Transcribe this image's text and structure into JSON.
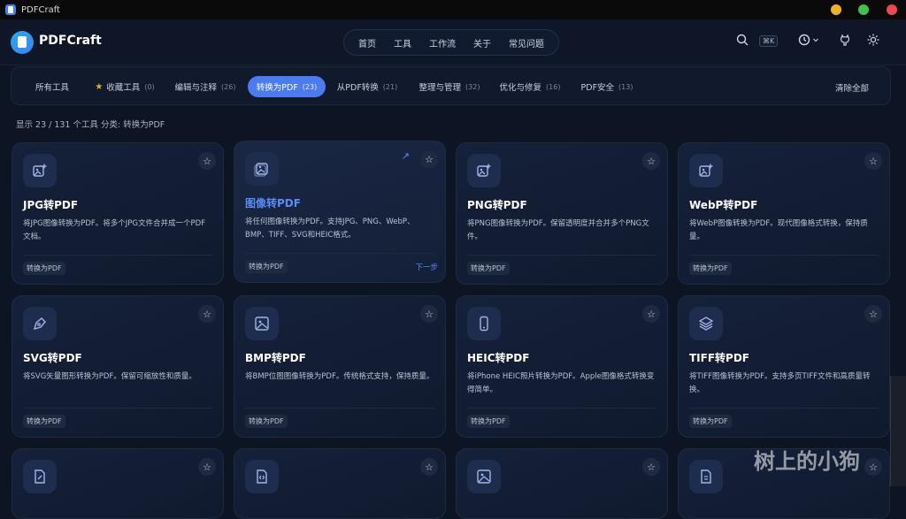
{
  "window": {
    "title": "PDFCraft"
  },
  "colors": {
    "accent": "#4c7bf0",
    "star": "#f5a524",
    "mac_yellow": "#f5b125",
    "mac_green": "#3ec04a",
    "mac_red": "#f04848"
  },
  "header": {
    "brand": "PDFCraft",
    "nav": [
      "首页",
      "工具",
      "工作流",
      "关于",
      "常见问题"
    ],
    "shortcut": "⌘K"
  },
  "filters": {
    "items": [
      {
        "label": "所有工具",
        "count": ""
      },
      {
        "label": "收藏工具",
        "count": "(0)"
      },
      {
        "label": "编辑与注释",
        "count": "(26)"
      },
      {
        "label": "转换为PDF",
        "count": "(23)"
      },
      {
        "label": "从PDF转换",
        "count": "(21)"
      },
      {
        "label": "整理与管理",
        "count": "(32)"
      },
      {
        "label": "优化与修复",
        "count": "(16)"
      },
      {
        "label": "PDF安全",
        "count": "(13)"
      }
    ],
    "clear": "清除全部"
  },
  "status": "显示 23 / 131 个工具 分类: 转换为PDF",
  "cards": [
    {
      "title": "JPG转PDF",
      "desc": "将JPG图像转换为PDF。将多个JPG文件合并成一个PDF文档。",
      "tag": "转换为PDF",
      "icon": "image-plus-icon"
    },
    {
      "title": "图像转PDF",
      "desc": "将任何图像转换为PDF。支持JPG、PNG、WebP、BMP、TIFF、SVG和HEIC格式。",
      "tag": "转换为PDF",
      "next": "下一步",
      "icon": "images-icon"
    },
    {
      "title": "PNG转PDF",
      "desc": "将PNG图像转换为PDF。保留透明度并合并多个PNG文件。",
      "tag": "转换为PDF",
      "icon": "image-plus-icon"
    },
    {
      "title": "WebP转PDF",
      "desc": "将WebP图像转换为PDF。现代图像格式转换，保持质量。",
      "tag": "转换为PDF",
      "icon": "image-plus-icon"
    },
    {
      "title": "SVG转PDF",
      "desc": "将SVG矢量图形转换为PDF。保留可缩放性和质量。",
      "tag": "转换为PDF",
      "icon": "pen-tool-icon"
    },
    {
      "title": "BMP转PDF",
      "desc": "将BMP位图图像转换为PDF。传统格式支持，保持质量。",
      "tag": "转换为PDF",
      "icon": "image-icon"
    },
    {
      "title": "HEIC转PDF",
      "desc": "将iPhone HEIC照片转换为PDF。Apple图像格式转换变得简单。",
      "tag": "转换为PDF",
      "icon": "smartphone-icon"
    },
    {
      "title": "TIFF转PDF",
      "desc": "将TIFF图像转换为PDF。支持多页TIFF文件和高质量转换。",
      "tag": "转换为PDF",
      "icon": "layers-icon"
    }
  ],
  "watermark": "树上的小狗"
}
